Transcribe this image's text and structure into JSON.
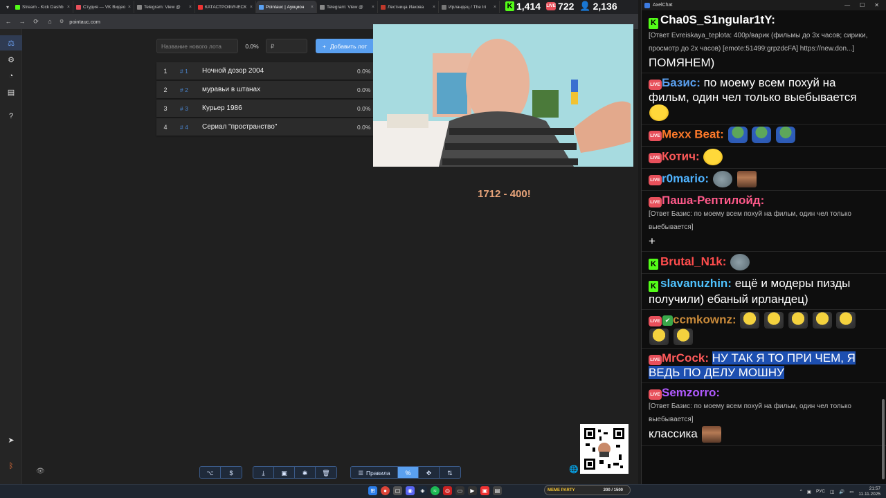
{
  "browser": {
    "tabs": [
      {
        "title": "Stream - Kick Dashb",
        "color": "#53fc18"
      },
      {
        "title": "Студия — VK Видео",
        "color": "#e8505b"
      },
      {
        "title": "Telegram: View @",
        "color": "#888888"
      },
      {
        "title": "КАТАСТРОФИЧЕСК",
        "color": "#e33"
      },
      {
        "title": "Pointauc | Аукцион",
        "color": "#5aa0f0",
        "active": true
      },
      {
        "title": "Telegram: View @",
        "color": "#888888"
      },
      {
        "title": "Лестница Иакова",
        "color": "#c0392b"
      },
      {
        "title": "Ирландец / The Iri",
        "color": "#777777"
      }
    ],
    "url": "pointauc.com"
  },
  "stats": {
    "kick_viewers": "1,414",
    "vk_viewers": "722",
    "total_viewers": "2,136",
    "kick_label": "K",
    "live_label": "LIVE"
  },
  "app": {
    "lot_name_placeholder": "Название нового лота",
    "percent": "0.0%",
    "price_placeholder": "₽",
    "add_button": "Добавить лот",
    "lots": [
      {
        "index": "1",
        "id": "# 1",
        "name": "Ночной дозор 2004",
        "pct": "0.0%"
      },
      {
        "index": "2",
        "id": "# 2",
        "name": "муравьи в штанах",
        "pct": "0.0%"
      },
      {
        "index": "3",
        "id": "# 3",
        "name": "Курьер 1986",
        "pct": "0.0%"
      },
      {
        "index": "4",
        "id": "# 4",
        "name": "Сериал \"пространство\"",
        "pct": "0.0%"
      }
    ],
    "overlay_text": "1712 - 400!",
    "toolbar": {
      "rules": "Правила",
      "percent_icon": "%"
    }
  },
  "chat": {
    "title": "AxelChat",
    "messages": [
      {
        "platform": "kick",
        "name": "Cha0S_S1ngular1tY:",
        "name_color": "#ffffff",
        "reply": "[Ответ Evreiskaya_teplota: 400р/варик (фильмы до 3х часов; сирики, просмотр до 2х часов) [emote:51499:grpzdcFA] https://new.don...]",
        "text": "ПОМЯНЕМ)"
      },
      {
        "platform": "live",
        "name": "Базис:",
        "name_color": "#5aa0f0",
        "text": "по моему всем похуй на фильм, один чел только выебывается"
      },
      {
        "platform": "live",
        "name": "Mexx Beat:",
        "name_color": "#ff7a2a",
        "text": ""
      },
      {
        "platform": "live",
        "name": "Котич:",
        "name_color": "#ff5a5a",
        "text": ""
      },
      {
        "platform": "live",
        "name": "r0mario:",
        "name_color": "#4fb3ff",
        "text": ""
      },
      {
        "platform": "live",
        "name": "Паша-Рептилойд:",
        "name_color": "#ff5a8a",
        "reply": "[Ответ Базис: по моему всем похуй на фильм, один чел только выебывается]",
        "text": "+"
      },
      {
        "platform": "kick",
        "name": "Brutal_N1k:",
        "name_color": "#ff4d4d",
        "text": ""
      },
      {
        "platform": "kick",
        "name": "slavanuzhin:",
        "name_color": "#4fc3ff",
        "text": "ещё и модеры пизды получили) ебаный ирландец)"
      },
      {
        "platform": "live",
        "name": "ccmkownz:",
        "name_color": "#c98a3a",
        "text": ""
      },
      {
        "platform": "live",
        "name": "MrCock:",
        "name_color": "#ff5a5a",
        "text": "НУ ТАК Я ТО ПРИ ЧЕМ, Я ВЕДЬ ПО ДЕЛУ МОШНУ"
      },
      {
        "platform": "live",
        "name": "Semzorro:",
        "name_color": "#b05aff",
        "reply": "[Ответ Базис: по моему всем похуй на фильм, один чел только выебывается]",
        "text": "классика"
      }
    ]
  },
  "taskbar": {
    "banner_title": "MEME PARTY",
    "banner_counter": "200 / 1500",
    "lang": "РУС",
    "time": "21:57",
    "date": "11.11.2025"
  }
}
